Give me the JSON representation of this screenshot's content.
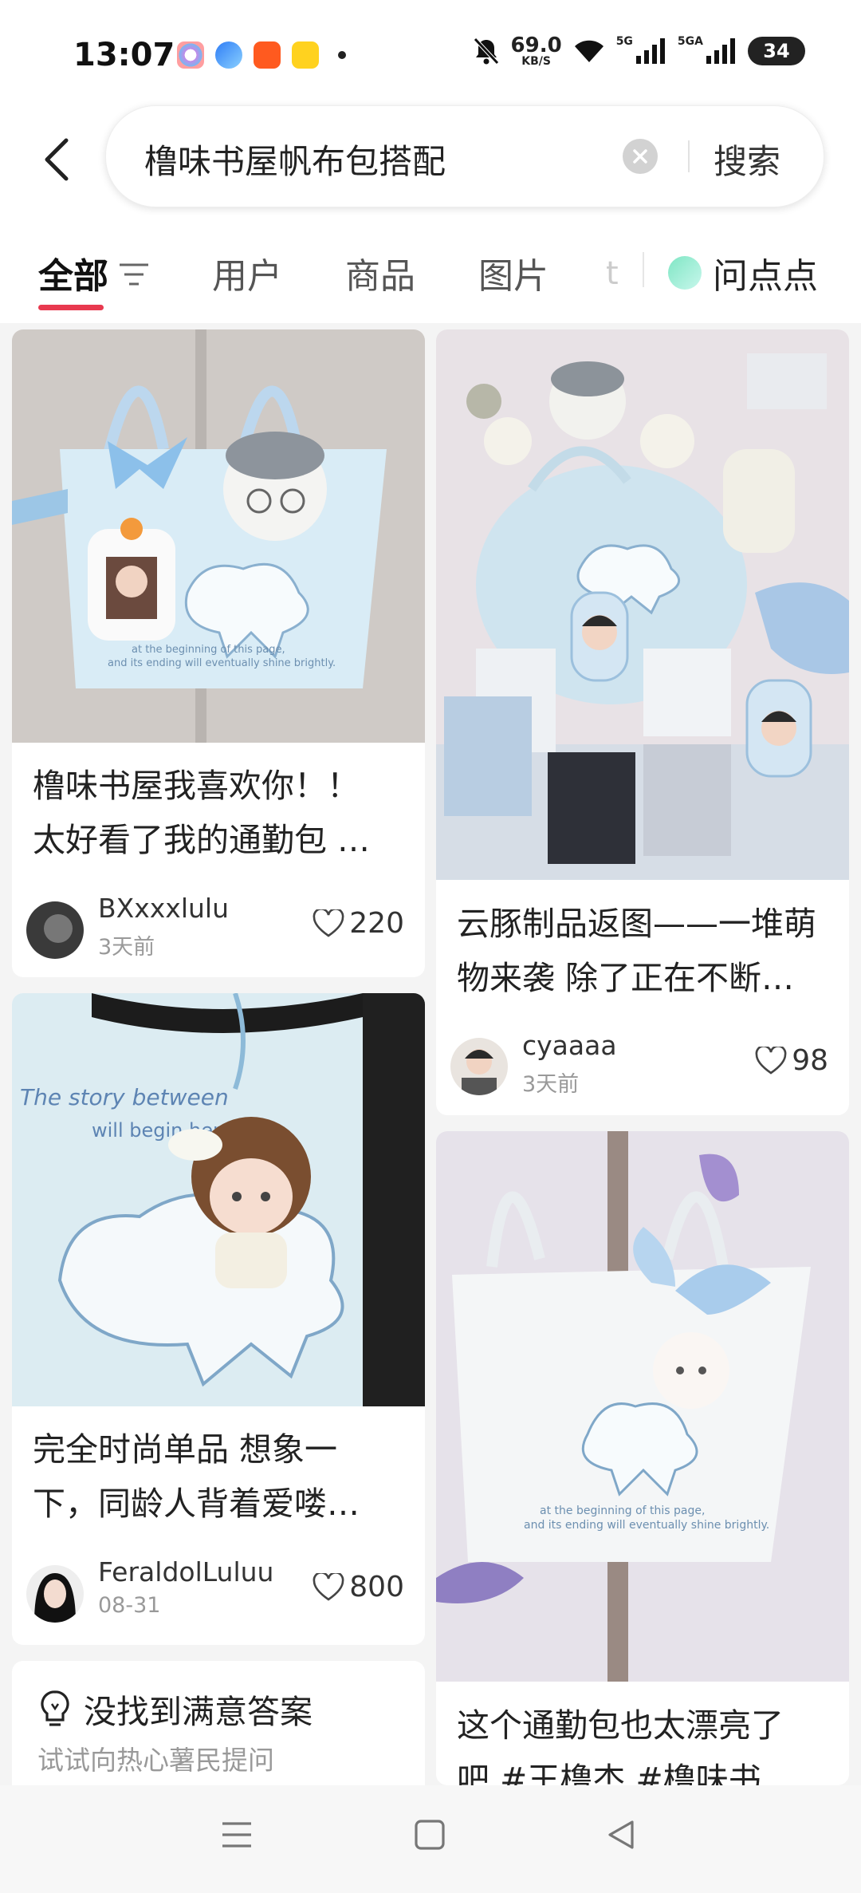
{
  "status": {
    "time": "13:07",
    "net_speed_value": "69.0",
    "net_speed_unit": "KB/S",
    "signal1_label": "5G",
    "signal2_label": "5GA",
    "battery": "34"
  },
  "search": {
    "query": "橹味书屋帆布包搭配",
    "button_label": "搜索"
  },
  "tabs": {
    "all": "全部",
    "users": "用户",
    "products": "商品",
    "images": "图片",
    "faded": "t",
    "ask": "问点点"
  },
  "posts": [
    {
      "title_line1": "橹味书屋我喜欢你！！",
      "title_line2": "太好看了我的通勤包 …",
      "author": "BXxxxlulu",
      "date": "3天前",
      "likes": "220"
    },
    {
      "title_line1": "云豚制品返图——一堆萌",
      "title_line2": "物来袭 除了正在不断…",
      "author": "cyaaaa",
      "date": "3天前",
      "likes": "98"
    },
    {
      "title_line1": "完全时尚单品 想象一",
      "title_line2": "下，同龄人背着爱喽…",
      "author": "FeraldolLuluu",
      "date": "08-31",
      "likes": "800"
    },
    {
      "title_line1": "这个通勤包也太漂亮了",
      "title_line2": "吧 #王橹杰 #橹味书…"
    }
  ],
  "prompt_card": {
    "title": "没找到满意答案",
    "subtitle": "试试向热心薯民提问"
  },
  "bag_print": {
    "line1": "at the beginning of this page,",
    "line2": "and its ending will eventually shine brightly.",
    "story": "The story between",
    "begin": "will begin here"
  }
}
